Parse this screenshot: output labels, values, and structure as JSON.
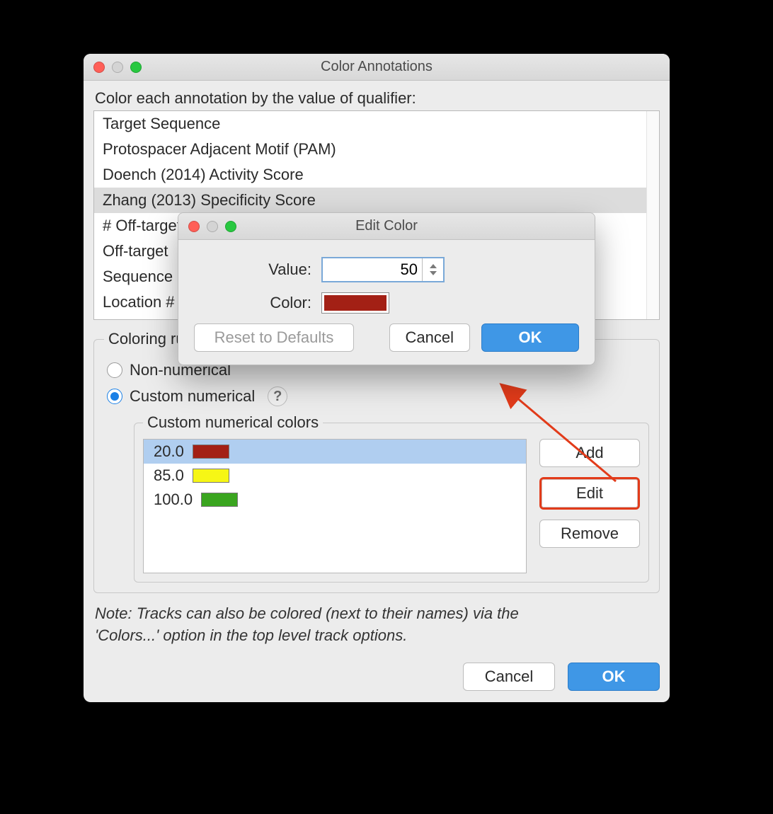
{
  "main": {
    "title": "Color Annotations",
    "prompt": "Color each annotation by the value of qualifier:",
    "qualifiers": [
      "Target Sequence",
      "Protospacer Adjacent Motif (PAM)",
      "Doench (2014) Activity Score",
      "Zhang (2013) Specificity Score",
      "# Off-targets",
      "Off-target",
      "Sequence",
      "Location #"
    ],
    "selected_qualifier_index": 3,
    "group_label": "Coloring rule",
    "radio_non_numerical": "Non-numerical",
    "radio_custom_numerical": "Custom numerical",
    "help_glyph": "?",
    "inner_group_label": "Custom numerical colors",
    "colors": [
      {
        "value": "20.0",
        "hex": "#a32015"
      },
      {
        "value": "85.0",
        "hex": "#f6f615"
      },
      {
        "value": "100.0",
        "hex": "#3aa51f"
      }
    ],
    "selected_color_index": 0,
    "buttons": {
      "add": "Add",
      "edit": "Edit",
      "remove": "Remove"
    },
    "note_line1": "Note: Tracks can also be colored (next to their names) via the",
    "note_line2": "'Colors...' option in the top level track options.",
    "cancel": "Cancel",
    "ok": "OK"
  },
  "modal": {
    "title": "Edit Color",
    "value_label": "Value:",
    "value": "50",
    "color_label": "Color:",
    "color_hex": "#a32015",
    "reset": "Reset to Defaults",
    "cancel": "Cancel",
    "ok": "OK"
  }
}
